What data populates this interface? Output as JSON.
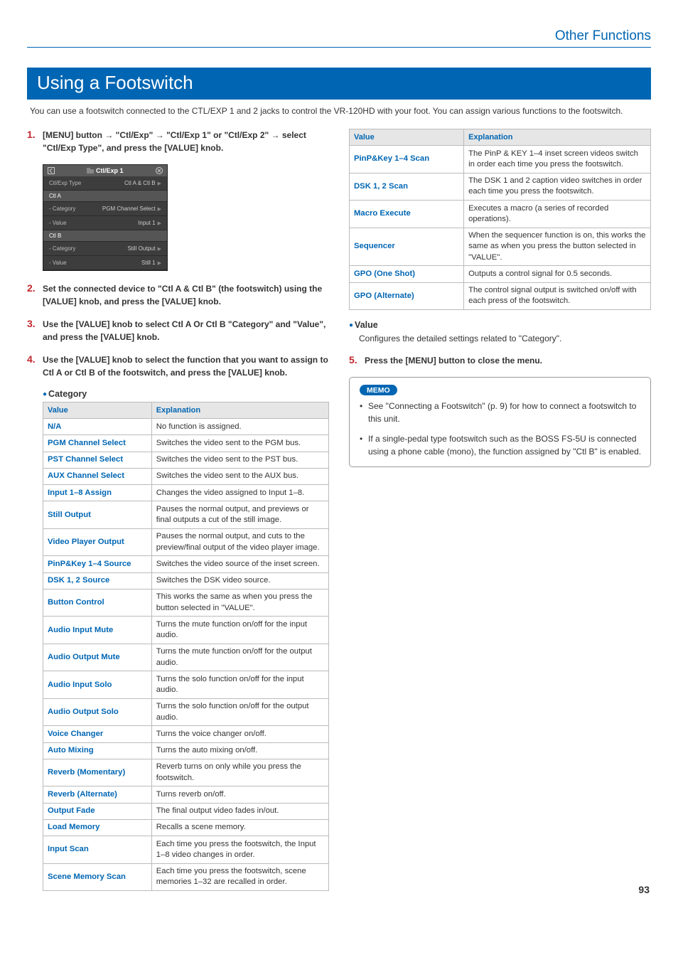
{
  "header": {
    "section": "Other Functions"
  },
  "title": "Using a Footswitch",
  "intro": "You can use a footswitch connected to the CTL/EXP 1 and 2 jacks to control the VR-120HD with your foot. You can assign various functions to the footswitch.",
  "steps": {
    "s1a": "[MENU] button ",
    "s1b": " \"Ctl/Exp\" ",
    "s1c": " \"Ctl/Exp 1\" or \"Ctl/Exp 2\" ",
    "s1d": " select \"Ctl/Exp Type\", and press the [VALUE] knob.",
    "s2": "Set the connected device to \"Ctl A & Ctl B\" (the footswitch) using the [VALUE] knob, and press the [VALUE] knob.",
    "s3": "Use the [VALUE] knob to select Ctl A Or Ctl B \"Category\" and \"Value\", and press the [VALUE] knob.",
    "s4": "Use the [VALUE] knob to select the function that you want to assign to Ctl A or Ctl B of the footswitch, and press the [VALUE] knob.",
    "s5": "Press the [MENU] button to close the menu."
  },
  "screenshot": {
    "title": "Ctl/Exp 1",
    "rows": [
      {
        "k": "Ctl/Exp Type",
        "v": "Ctl A & Ctl B"
      },
      {
        "header": "Ctl A"
      },
      {
        "k": "- Category",
        "v": "PGM Channel Select"
      },
      {
        "k": "- Value",
        "v": "Input 1"
      },
      {
        "header": "Ctl B"
      },
      {
        "k": "- Category",
        "v": "Still Output"
      },
      {
        "k": "- Value",
        "v": "Still 1"
      }
    ]
  },
  "headings": {
    "category": "Category",
    "value": "Value"
  },
  "table_headers": {
    "value": "Value",
    "explanation": "Explanation"
  },
  "category_table": [
    {
      "k": "N/A",
      "v": "No function is assigned."
    },
    {
      "k": "PGM Channel Select",
      "v": "Switches the video sent to the PGM bus."
    },
    {
      "k": "PST Channel Select",
      "v": "Switches the video sent to the PST bus."
    },
    {
      "k": "AUX Channel Select",
      "v": "Switches the video sent to the AUX bus."
    },
    {
      "k": "Input 1–8 Assign",
      "v": "Changes the video assigned to Input 1–8."
    },
    {
      "k": "Still Output",
      "v": "Pauses the normal output, and previews or final outputs a cut of the still image."
    },
    {
      "k": "Video Player Output",
      "v": "Pauses the normal output, and cuts to the preview/final output of the video player image."
    },
    {
      "k": "PinP&Key 1–4 Source",
      "v": "Switches the video source of the inset screen."
    },
    {
      "k": "DSK 1, 2 Source",
      "v": "Switches the DSK video source."
    },
    {
      "k": "Button Control",
      "v": "This works the same as when you press the button selected in \"VALUE\"."
    },
    {
      "k": "Audio Input Mute",
      "v": "Turns the mute function on/off for the input audio."
    },
    {
      "k": "Audio Output Mute",
      "v": "Turns the mute function on/off for the output audio."
    },
    {
      "k": "Audio Input Solo",
      "v": "Turns the solo function on/off for the input audio."
    },
    {
      "k": "Audio Output Solo",
      "v": "Turns the solo function on/off for the output audio."
    },
    {
      "k": "Voice Changer",
      "v": "Turns the voice changer on/off."
    },
    {
      "k": "Auto Mixing",
      "v": "Turns the auto mixing on/off."
    },
    {
      "k": "Reverb (Momentary)",
      "v": "Reverb turns on only while you press the footswitch."
    },
    {
      "k": "Reverb (Alternate)",
      "v": "Turns reverb on/off."
    },
    {
      "k": "Output Fade",
      "v": "The final output video fades in/out."
    },
    {
      "k": "Load Memory",
      "v": "Recalls a scene memory."
    },
    {
      "k": "Input Scan",
      "v": "Each time you press the footswitch, the Input 1–8 video changes in order."
    },
    {
      "k": "Scene Memory Scan",
      "v": "Each time you press the footswitch, scene memories 1–32 are recalled in order."
    }
  ],
  "category_table2": [
    {
      "k": "PinP&Key 1–4 Scan",
      "v": "The PinP & KEY 1–4 inset screen videos switch in order each time you press the footswitch."
    },
    {
      "k": "DSK 1, 2 Scan",
      "v": "The DSK 1 and 2 caption video switches in order each time you press the footswitch."
    },
    {
      "k": "Macro Execute",
      "v": "Executes a macro (a series of recorded operations)."
    },
    {
      "k": "Sequencer",
      "v": "When the sequencer function is on, this works the same as when you press the button selected in \"VALUE\"."
    },
    {
      "k": "GPO (One Shot)",
      "v": "Outputs a control signal for 0.5 seconds."
    },
    {
      "k": "GPO (Alternate)",
      "v": "The control signal output is switched on/off with each press of the footswitch."
    }
  ],
  "value_desc": "Configures the detailed settings related to \"Category\".",
  "memo": {
    "label": "MEMO",
    "items": [
      "See \"Connecting a Footswitch\" (p. 9) for how to connect a footswitch to this unit.",
      "If a single-pedal type footswitch such as the BOSS FS-5U is connected using a phone cable (mono), the function assigned by \"Ctl B\" is enabled."
    ]
  },
  "page_number": "93"
}
